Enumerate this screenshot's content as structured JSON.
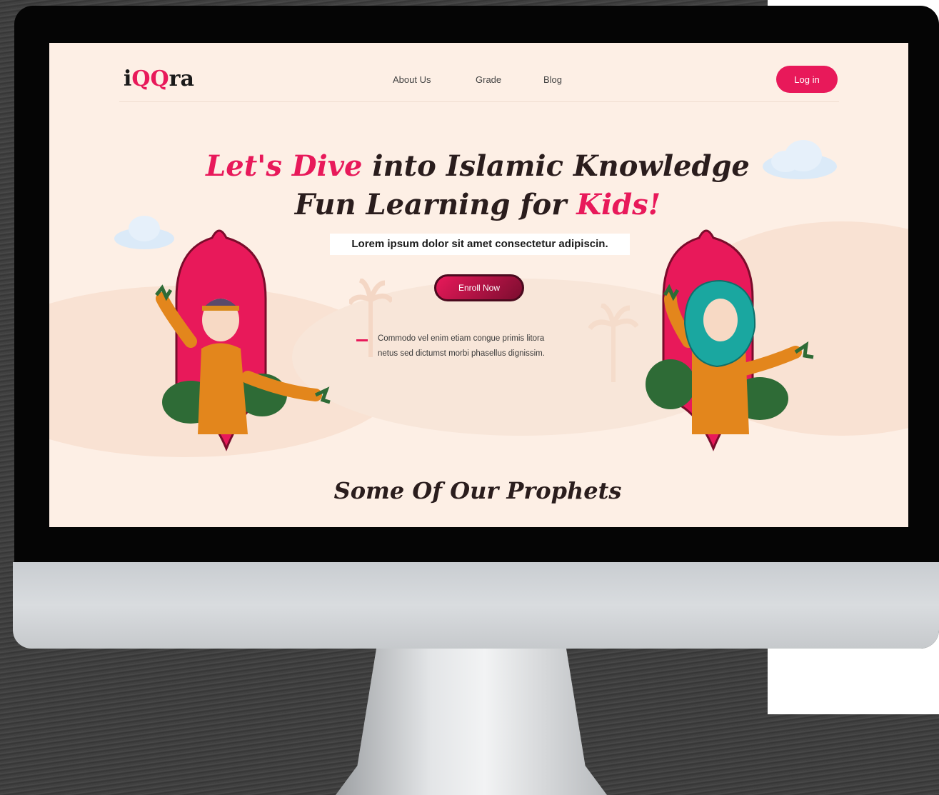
{
  "header": {
    "logo": {
      "prefix": "i",
      "highlight": "QQ",
      "suffix": "ra"
    },
    "nav": [
      "About Us",
      "Grade",
      "Blog"
    ],
    "login_label": "Log in"
  },
  "hero": {
    "headline_line1_pink": "Let's Dive",
    "headline_line1_rest": " into Islamic Knowledge",
    "headline_line2_rest": "Fun Learning for ",
    "headline_line2_pink": "Kids!",
    "subtitle": "Lorem ipsum dolor sit amet consectetur adipiscin.",
    "cta_label": "Enroll Now",
    "quote_line1": "Commodo vel enim etiam congue primis litora",
    "quote_line2": "netus sed dictumst morbi phasellus dignissim."
  },
  "section": {
    "title": "Some Of Our Prophets"
  },
  "colors": {
    "accent": "#e8195a",
    "background": "#fdefe5",
    "dark_text": "#2a1d1d"
  },
  "icons": [
    "cloud-icon",
    "palm-tree-icon",
    "boy-illustration",
    "girl-illustration",
    "arch-frame-icon"
  ]
}
